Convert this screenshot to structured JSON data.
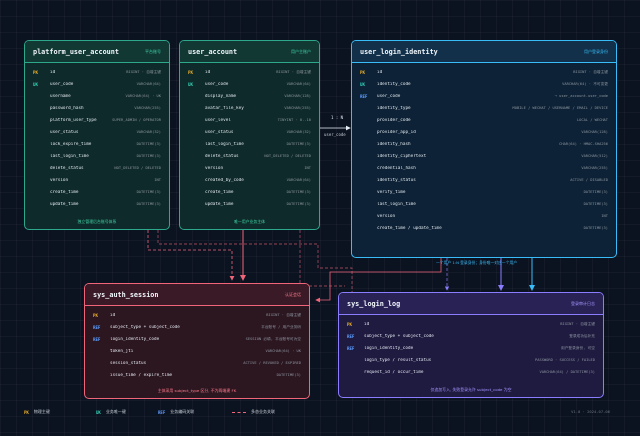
{
  "entities": {
    "platform_user_account": {
      "title": "platform_user_account",
      "tag": "平台账号",
      "rows": [
        {
          "key": "PK",
          "name": "id",
          "type": "BIGINT · 自增主键"
        },
        {
          "key": "UK",
          "name": "user_code",
          "type": "VARCHAR(64)"
        },
        {
          "key": "",
          "name": "username",
          "type": "VARCHAR(64) · UK"
        },
        {
          "key": "",
          "name": "password_hash",
          "type": "VARCHAR(255)"
        },
        {
          "key": "",
          "name": "platform_user_type",
          "type": "SUPER_ADMIN / OPERATOR"
        },
        {
          "key": "",
          "name": "user_status",
          "type": "VARCHAR(32)"
        },
        {
          "key": "",
          "name": "lock_expire_time",
          "type": "DATETIME(3)"
        },
        {
          "key": "",
          "name": "last_login_time",
          "type": "DATETIME(3)"
        },
        {
          "key": "",
          "name": "delete_status",
          "type": "NOT_DELETED / DELETED"
        },
        {
          "key": "",
          "name": "version",
          "type": "INT"
        },
        {
          "key": "",
          "name": "create_time",
          "type": "DATETIME(3)"
        },
        {
          "key": "",
          "name": "update_time",
          "type": "DATETIME(3)"
        }
      ],
      "footer": "独立管理后台账号体系"
    },
    "user_account": {
      "title": "user_account",
      "tag": "用户主账户",
      "rows": [
        {
          "key": "PK",
          "name": "id",
          "type": "BIGINT · 自增主键"
        },
        {
          "key": "UK",
          "name": "user_code",
          "type": "VARCHAR(64)"
        },
        {
          "key": "",
          "name": "display_name",
          "type": "VARCHAR(128)"
        },
        {
          "key": "",
          "name": "avatar_file_key",
          "type": "VARCHAR(255)"
        },
        {
          "key": "",
          "name": "user_level",
          "type": "TINYINT · 0..10"
        },
        {
          "key": "",
          "name": "user_status",
          "type": "VARCHAR(32)"
        },
        {
          "key": "",
          "name": "last_login_time",
          "type": "DATETIME(3)"
        },
        {
          "key": "",
          "name": "delete_status",
          "type": "NOT_DELETED / DELETED"
        },
        {
          "key": "",
          "name": "version",
          "type": "INT"
        },
        {
          "key": "",
          "name": "created_by_code",
          "type": "VARCHAR(64)"
        },
        {
          "key": "",
          "name": "create_time",
          "type": "DATETIME(3)"
        },
        {
          "key": "",
          "name": "update_time",
          "type": "DATETIME(3)"
        }
      ],
      "footer": "唯一用户业务主体"
    },
    "user_login_identity": {
      "title": "user_login_identity",
      "tag": "用户登录身份",
      "rows": [
        {
          "key": "PK",
          "name": "id",
          "type": "BIGINT · 自增主键"
        },
        {
          "key": "UK",
          "name": "identity_code",
          "type": "VARCHAR(64) · 不可变更"
        },
        {
          "key": "REF",
          "name": "user_code",
          "type": "→ user_account.user_code"
        },
        {
          "key": "",
          "name": "identity_type",
          "type": "MOBILE / WECHAT / USERNAME / EMAIL / DEVICE"
        },
        {
          "key": "",
          "name": "provider_code",
          "type": "LOCAL / WECHAT"
        },
        {
          "key": "",
          "name": "provider_app_id",
          "type": "VARCHAR(128)"
        },
        {
          "key": "",
          "name": "identity_hash",
          "type": "CHAR(64) · HMAC-SHA256"
        },
        {
          "key": "",
          "name": "identity_ciphertext",
          "type": "VARCHAR(512)"
        },
        {
          "key": "",
          "name": "credential_hash",
          "type": "VARCHAR(255)"
        },
        {
          "key": "",
          "name": "identity_status",
          "type": "ACTIVE / DISABLED"
        },
        {
          "key": "",
          "name": "verify_time",
          "type": "DATETIME(3)"
        },
        {
          "key": "",
          "name": "last_login_time",
          "type": "DATETIME(3)"
        },
        {
          "key": "",
          "name": "version",
          "type": "INT"
        },
        {
          "key": "",
          "name": "create_time / update_time",
          "type": "DATETIME(3)"
        }
      ]
    },
    "sys_auth_session": {
      "title": "sys_auth_session",
      "tag": "认证会话",
      "rows": [
        {
          "key": "PK",
          "name": "id",
          "type": "BIGINT · 自增主键"
        },
        {
          "key": "REF",
          "name": "subject_type + subject_code",
          "type": "平台账号 / 用户业务码"
        },
        {
          "key": "REF",
          "name": "login_identity_code",
          "type": "SESSION 必填, 平台账号可为空"
        },
        {
          "key": "",
          "name": "token_jti",
          "type": "VARCHAR(64) · UK"
        },
        {
          "key": "",
          "name": "session_status",
          "type": "ACTIVE / REVOKED / EXPIRED"
        },
        {
          "key": "",
          "name": "issue_time / expire_time",
          "type": "DATETIME(3)"
        }
      ],
      "footer": "主体采用 subject_type 区分, 不为两端建 FK"
    },
    "sys_login_log": {
      "title": "sys_login_log",
      "tag": "登录审计日志",
      "rows": [
        {
          "key": "PK",
          "name": "id",
          "type": "BIGINT · 自增主键"
        },
        {
          "key": "REF",
          "name": "subject_type + subject_code",
          "type": "登录成功后补充"
        },
        {
          "key": "REF",
          "name": "login_identity_code",
          "type": "用户登录身份, 可空"
        },
        {
          "key": "",
          "name": "login_type / result_status",
          "type": "PASSWORD · SUCCESS / FAILED"
        },
        {
          "key": "",
          "name": "request_id / occur_time",
          "type": "VARCHAR(64) / DATETIME(3)"
        }
      ],
      "footer": "仅追加写入, 失败登录允许 subject_code 为空"
    }
  },
  "relations": {
    "one_to_many": "1 : N",
    "via_user_code": "user_code",
    "identity_note": "一个用户 1:N 登录身份；身份唯一对应一个用户"
  },
  "legend": {
    "pk_key": "PK",
    "pk_label": "物理主键",
    "uk_key": "UK",
    "uk_label": "业务唯一键",
    "ref_key": "REF",
    "ref_label": "业务编码关联",
    "dash_label": "多态业务关联"
  },
  "version_text": "V1.0 · 2024-07-06",
  "colors": {
    "green": "#2ea88b",
    "blue": "#38bdf8",
    "red": "#f0657a",
    "purple": "#8b7dff",
    "pk": "#f0b429",
    "uk": "#34d1b6",
    "ref": "#5b9dff"
  }
}
